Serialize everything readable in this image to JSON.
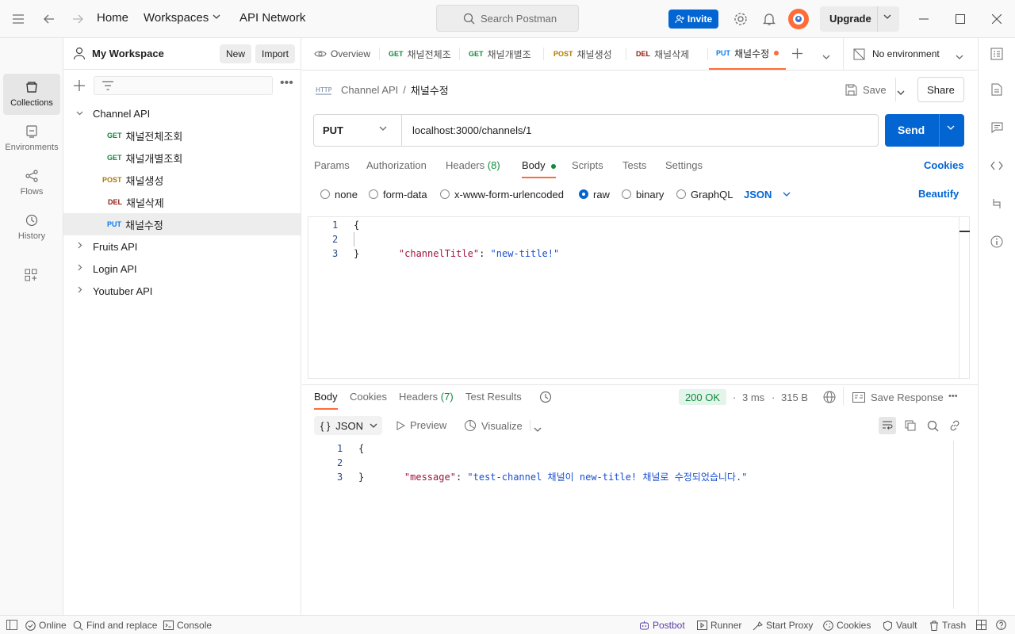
{
  "titlebar": {
    "home": "Home",
    "workspaces": "Workspaces",
    "api_network": "API Network",
    "search_placeholder": "Search Postman",
    "invite": "Invite",
    "upgrade": "Upgrade"
  },
  "rail": {
    "collections": "Collections",
    "environments": "Environments",
    "flows": "Flows",
    "history": "History"
  },
  "sidebar": {
    "workspace_title": "My Workspace",
    "new_label": "New",
    "import_label": "Import",
    "tree": [
      {
        "label": "Channel API",
        "type": "folder",
        "expanded": true
      },
      {
        "method": "GET",
        "label": "채널전체조회"
      },
      {
        "method": "GET",
        "label": "채널개별조회"
      },
      {
        "method": "POST",
        "label": "채널생성"
      },
      {
        "method": "DEL",
        "label": "채널삭제"
      },
      {
        "method": "PUT",
        "label": "채널수정",
        "selected": true
      },
      {
        "label": "Fruits API",
        "type": "folder"
      },
      {
        "label": "Login API",
        "type": "folder"
      },
      {
        "label": "Youtuber API",
        "type": "folder"
      }
    ]
  },
  "tabs": {
    "overview": "Overview",
    "items": [
      {
        "method": "GET",
        "label": "채널전체조"
      },
      {
        "method": "GET",
        "label": "채널개별조"
      },
      {
        "method": "POST",
        "label": "채널생성"
      },
      {
        "method": "DEL",
        "label": "채널삭제"
      },
      {
        "method": "PUT",
        "label": "채널수정",
        "active": true,
        "unsaved": true
      }
    ],
    "environment": "No environment"
  },
  "request": {
    "breadcrumb_parent": "Channel API",
    "breadcrumb_sep": "/",
    "breadcrumb_current": "채널수정",
    "save": "Save",
    "share": "Share",
    "method": "PUT",
    "url": "localhost:3000/channels/1",
    "send": "Send",
    "tabs": {
      "params": "Params",
      "authorization": "Authorization",
      "headers": "Headers",
      "headers_count": "(8)",
      "body": "Body",
      "scripts": "Scripts",
      "tests": "Tests",
      "settings": "Settings"
    },
    "cookies": "Cookies",
    "body_modes": {
      "none": "none",
      "form_data": "form-data",
      "urlencoded": "x-www-form-urlencoded",
      "raw": "raw",
      "binary": "binary",
      "graphql": "GraphQL"
    },
    "raw_format": "JSON",
    "beautify": "Beautify",
    "body_lines": {
      "ln1": "1",
      "ln2": "2",
      "ln3": "3",
      "open": "{",
      "key": "\"channelTitle\"",
      "colon": ": ",
      "value": "\"new-title!\"",
      "close": "}"
    }
  },
  "response": {
    "tabs": {
      "body": "Body",
      "cookies": "Cookies",
      "headers": "Headers",
      "headers_count": "(7)",
      "test_results": "Test Results"
    },
    "status": "200 OK",
    "time": "3 ms",
    "size": "315 B",
    "save_response": "Save Response",
    "format": "JSON",
    "preview": "Preview",
    "visualize": "Visualize",
    "body_lines": {
      "ln1": "1",
      "ln2": "2",
      "ln3": "3",
      "open": "{",
      "key": "\"message\"",
      "colon": ": ",
      "value": "\"test-channel 채널이 new-title! 채널로 수정되었습니다.\"",
      "close": "}"
    }
  },
  "statusbar": {
    "online": "Online",
    "find_replace": "Find and replace",
    "console": "Console",
    "postbot": "Postbot",
    "runner": "Runner",
    "start_proxy": "Start Proxy",
    "cookies": "Cookies",
    "vault": "Vault",
    "trash": "Trash"
  },
  "colors": {
    "accent": "#ff6c37",
    "primary": "#0265d2",
    "get": "#0f8a3c",
    "post": "#ad7a03",
    "delete": "#8e1a10",
    "put": "#097bed"
  }
}
